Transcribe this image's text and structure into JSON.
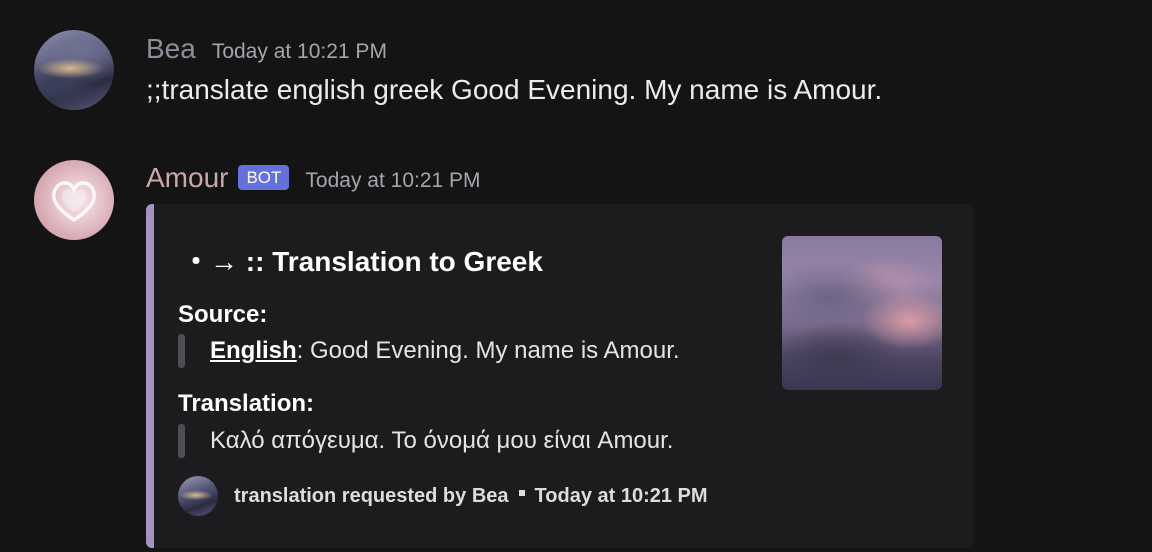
{
  "messages": [
    {
      "author": "Bea",
      "timestamp": "Today at 10:21 PM",
      "content": ";;translate english greek Good Evening. My name is Amour."
    },
    {
      "author": "Amour",
      "bot_tag": "BOT",
      "timestamp": "Today at 10:21 PM",
      "embed": {
        "title": "・→ :: Translation to Greek",
        "source_label": "Source:",
        "source_language": "English",
        "source_text": ": Good Evening. My name is Amour.",
        "translation_label": "Translation:",
        "translation_text": "Καλό απόγευμα. Το όνομά μου είναι Amour.",
        "footer_text": "translation requested by Bea",
        "footer_timestamp": "Today at 10:21 PM",
        "accent_color": "#a793c0"
      }
    }
  ],
  "colors": {
    "background": "#141414",
    "embed_background": "#1c1c1e",
    "bot_tag": "#6470dc"
  }
}
